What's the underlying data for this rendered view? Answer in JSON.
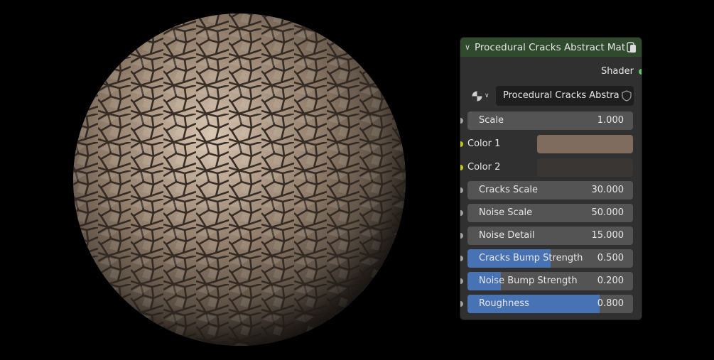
{
  "node": {
    "title": "Procedural Cracks Abstract Material",
    "header_color": "#2f4a2c",
    "output_label": "Shader",
    "material_name": "Procedural Cracks Abstract ...",
    "inputs": {
      "scale": {
        "label": "Scale",
        "value": "1.000"
      },
      "color1": {
        "label": "Color 1",
        "color": "#806c5e"
      },
      "color2": {
        "label": "Color 2",
        "color": "#3a3634"
      },
      "cracks_scale": {
        "label": "Cracks Scale",
        "value": "30.000"
      },
      "noise_scale": {
        "label": "Noise Scale",
        "value": "50.000"
      },
      "noise_detail": {
        "label": "Noise Detail",
        "value": "15.000"
      },
      "cracks_bump": {
        "label": "Cracks Bump Strength",
        "value": "0.500",
        "fraction": 0.5
      },
      "noise_bump": {
        "label": "Noise Bump Strength",
        "value": "0.200",
        "fraction": 0.2
      },
      "roughness": {
        "label": "Roughness",
        "value": "0.800",
        "fraction": 0.8
      }
    }
  }
}
